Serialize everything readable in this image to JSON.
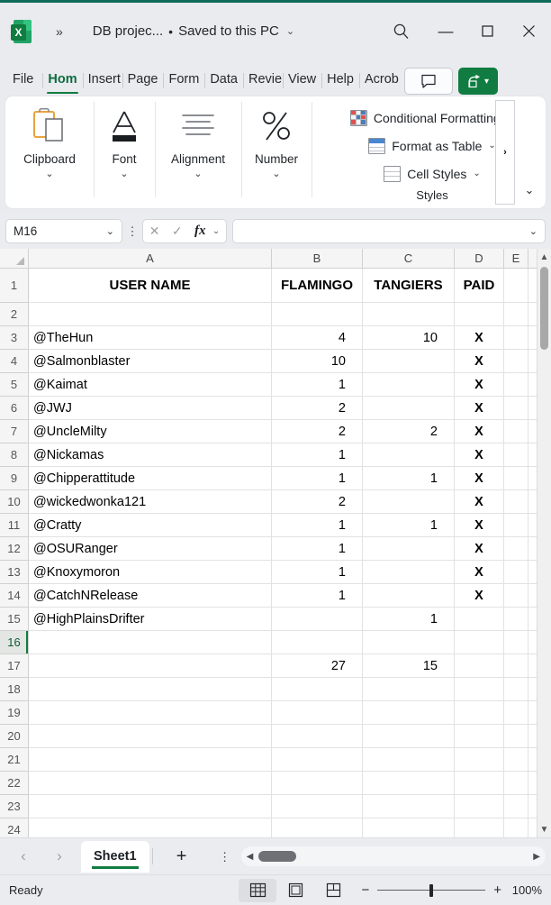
{
  "titlebar": {
    "logo_letter": "X",
    "more_commands": "»",
    "document_name": "DB projec...",
    "separator": "•",
    "save_state": "Saved to this PC",
    "caret": "⌄",
    "search_icon": "search-icon",
    "minimize": "—",
    "maximize": "□",
    "close": "✕"
  },
  "tabs": [
    {
      "label": "File",
      "selected": false
    },
    {
      "label": "Hom",
      "selected": true
    },
    {
      "label": "Insert",
      "selected": false
    },
    {
      "label": "Page",
      "selected": false
    },
    {
      "label": "Form",
      "selected": false
    },
    {
      "label": "Data",
      "selected": false
    },
    {
      "label": "Revie",
      "selected": false
    },
    {
      "label": "View",
      "selected": false
    },
    {
      "label": "Help",
      "selected": false
    },
    {
      "label": "Acrob",
      "selected": false
    }
  ],
  "ribbon": {
    "groups": [
      {
        "label": "Clipboard",
        "caret": "⌄"
      },
      {
        "label": "Font",
        "caret": "⌄"
      },
      {
        "label": "Alignment",
        "caret": "⌄"
      },
      {
        "label": "Number",
        "caret": "⌄"
      }
    ],
    "styles": {
      "label": "Styles",
      "items": [
        {
          "label": "Conditional Formatting",
          "caret": "⌄"
        },
        {
          "label": "Format as Table",
          "caret": "⌄"
        },
        {
          "label": "Cell Styles",
          "caret": "⌄"
        }
      ],
      "scroll_more": "›",
      "collapse": "⌄"
    }
  },
  "formula_bar": {
    "name_box_value": "M16",
    "name_box_caret": "⌄",
    "options_dots": "⋮",
    "cancel": "✕",
    "enter": "✓",
    "fx": "fx",
    "fx_caret": "⌄",
    "formula_value": "",
    "formula_caret": "⌄"
  },
  "grid": {
    "columns": [
      "A",
      "B",
      "C",
      "D",
      "E"
    ],
    "selected_row": 16,
    "rows": [
      {
        "num": 1,
        "a": "USER NAME",
        "b": "FLAMINGO",
        "c": "TANGIERS",
        "d": "PAID",
        "header": true
      },
      {
        "num": 2,
        "a": "",
        "b": "",
        "c": "",
        "d": ""
      },
      {
        "num": 3,
        "a": "@TheHun",
        "b": "4",
        "c": "10",
        "d": "X"
      },
      {
        "num": 4,
        "a": "@Salmonblaster",
        "b": "10",
        "c": "",
        "d": "X"
      },
      {
        "num": 5,
        "a": "@Kaimat",
        "b": "1",
        "c": "",
        "d": "X"
      },
      {
        "num": 6,
        "a": "@JWJ",
        "b": "2",
        "c": "",
        "d": "X"
      },
      {
        "num": 7,
        "a": "@UncleMilty",
        "b": "2",
        "c": "2",
        "d": "X"
      },
      {
        "num": 8,
        "a": "@Nickamas",
        "b": "1",
        "c": "",
        "d": "X"
      },
      {
        "num": 9,
        "a": "@Chipperattitude",
        "b": "1",
        "c": "1",
        "d": "X"
      },
      {
        "num": 10,
        "a": "@wickedwonka121",
        "b": "2",
        "c": "",
        "d": "X"
      },
      {
        "num": 11,
        "a": "@Cratty",
        "b": "1",
        "c": "1",
        "d": "X"
      },
      {
        "num": 12,
        "a": "@OSURanger",
        "b": "1",
        "c": "",
        "d": "X"
      },
      {
        "num": 13,
        "a": "@Knoxymoron",
        "b": "1",
        "c": "",
        "d": "X"
      },
      {
        "num": 14,
        "a": "@CatchNRelease",
        "b": "1",
        "c": "",
        "d": "X"
      },
      {
        "num": 15,
        "a": "@HighPlainsDrifter",
        "b": "",
        "c": "1",
        "d": ""
      },
      {
        "num": 16,
        "a": "",
        "b": "",
        "c": "",
        "d": ""
      },
      {
        "num": 17,
        "a": "",
        "b": "27",
        "c": "15",
        "d": ""
      },
      {
        "num": 18,
        "a": "",
        "b": "",
        "c": "",
        "d": ""
      },
      {
        "num": 19,
        "a": "",
        "b": "",
        "c": "",
        "d": ""
      },
      {
        "num": 20,
        "a": "",
        "b": "",
        "c": "",
        "d": ""
      },
      {
        "num": 21,
        "a": "",
        "b": "",
        "c": "",
        "d": ""
      },
      {
        "num": 22,
        "a": "",
        "b": "",
        "c": "",
        "d": ""
      },
      {
        "num": 23,
        "a": "",
        "b": "",
        "c": "",
        "d": ""
      },
      {
        "num": 24,
        "a": "",
        "b": "",
        "c": "",
        "d": ""
      }
    ],
    "scroll_up": "▲",
    "scroll_down": "▼"
  },
  "sheetbar": {
    "prev": "‹",
    "next": "›",
    "sheets": [
      {
        "name": "Sheet1",
        "active": true
      }
    ],
    "add_sheet": "+",
    "options_dots": "⋮",
    "hscroll_left": "◀",
    "hscroll_right": "▶"
  },
  "statusbar": {
    "status": "Ready",
    "views": [
      {
        "name": "normal-view",
        "active": true
      },
      {
        "name": "page-layout-view",
        "active": false
      },
      {
        "name": "page-break-view",
        "active": false
      }
    ],
    "zoom_out": "−",
    "zoom_in": "+",
    "zoom_level": "100%"
  },
  "colors": {
    "excel_green": "#107c41",
    "accent_dark": "#0e6b5a",
    "chrome": "#e9ebef"
  }
}
